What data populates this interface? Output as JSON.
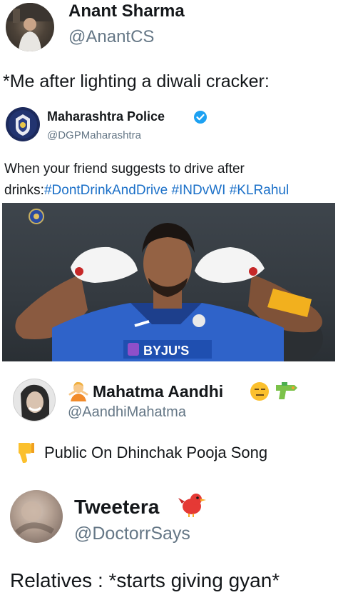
{
  "tweet1": {
    "name": "Anant Sharma",
    "handle": "@AnantCS",
    "text": "*Me after lighting a diwali cracker:"
  },
  "tweet2": {
    "name": "Maharashtra Police",
    "handle": "@DGPMaharashtra",
    "text_line1": "When your friend suggests to drive after",
    "text_prefix": "drinks:",
    "hashtags": [
      "#DontDrinkAndDrive",
      "#INDvWI",
      "#KLRahul"
    ],
    "image": {
      "jersey_logo": "BYJU'S",
      "colors": {
        "jersey": "#2f63c9",
        "background": "#3c4248",
        "wristband": "#f2b01e",
        "gloves": "#f4f4f4"
      }
    },
    "verified_icon": "verified-badge-icon"
  },
  "tweet3": {
    "name": "Mahatma Aandhi",
    "handle": "@AandhiMahatma",
    "text": "Public On Dhinchak Pooja Song",
    "icons": [
      "person-gesturing-emoji",
      "expressionless-face-emoji",
      "water-pistol-emoji",
      "thumbs-down-emoji"
    ]
  },
  "tweet4": {
    "name": "Tweetera",
    "handle": "@DoctorrSays",
    "text": "Relatives : *starts giving gyan*",
    "icons": [
      "red-bird-emoji"
    ]
  }
}
